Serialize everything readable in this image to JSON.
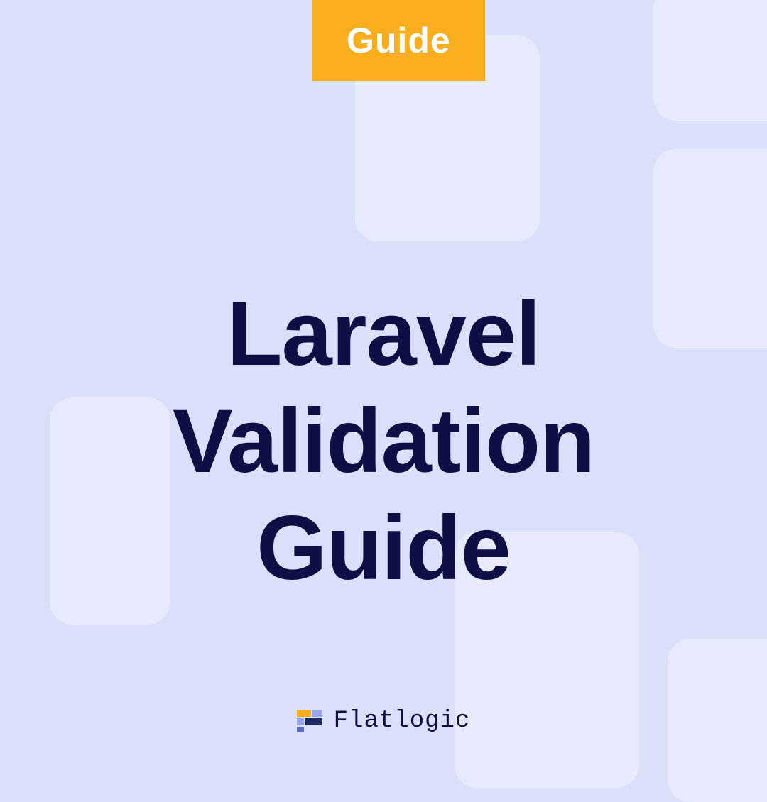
{
  "badge": {
    "label": "Guide"
  },
  "title": {
    "line1": "Laravel",
    "line2": "Validation",
    "line3": "Guide"
  },
  "brand": {
    "name": "Flatlogic"
  }
}
